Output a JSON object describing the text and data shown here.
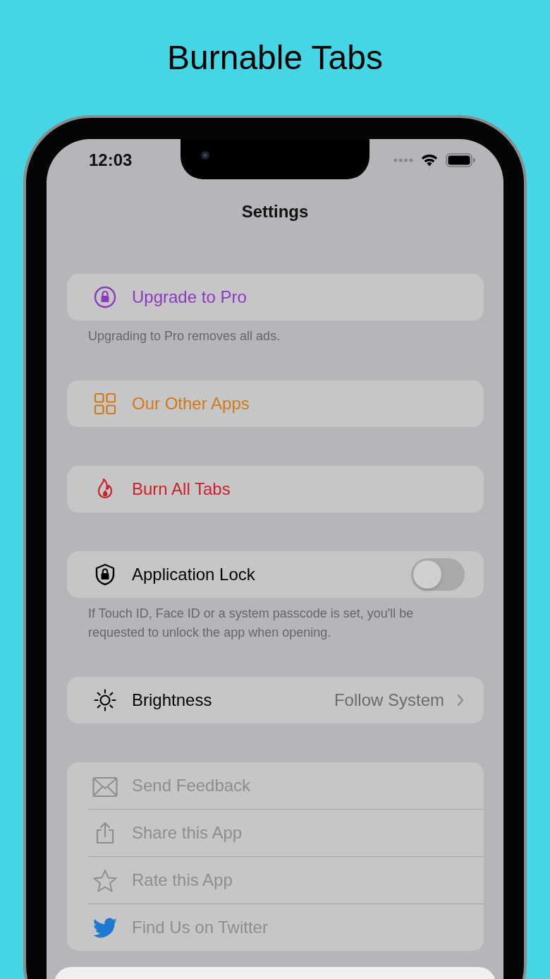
{
  "headline": "Burnable Tabs",
  "status_bar": {
    "time": "12:03"
  },
  "nav": {
    "title": "Settings"
  },
  "sections": [
    {
      "rows": [
        {
          "kind": "link",
          "label": "Upgrade to Pro",
          "color": "#8b3bbf"
        }
      ],
      "footer": "Upgrading to Pro removes all ads."
    },
    {
      "rows": [
        {
          "kind": "link",
          "label": "Our Other Apps",
          "color": "#d07a1a"
        }
      ]
    },
    {
      "rows": [
        {
          "kind": "link",
          "label": "Burn All Tabs",
          "color": "#c8222a"
        }
      ]
    },
    {
      "rows": [
        {
          "kind": "toggle",
          "label": "Application Lock",
          "on": false
        }
      ],
      "footer": "If Touch ID, Face ID or a system passcode is set, you'll be requested to unlock the app when opening."
    },
    {
      "rows": [
        {
          "kind": "disclosure",
          "label": "Brightness",
          "value": "Follow System"
        }
      ]
    },
    {
      "rows": [
        {
          "kind": "muted",
          "label": "Send Feedback"
        },
        {
          "kind": "muted",
          "label": "Share this App"
        },
        {
          "kind": "muted",
          "label": "Rate this App"
        },
        {
          "kind": "muted",
          "label": "Find Us on Twitter"
        }
      ]
    }
  ]
}
